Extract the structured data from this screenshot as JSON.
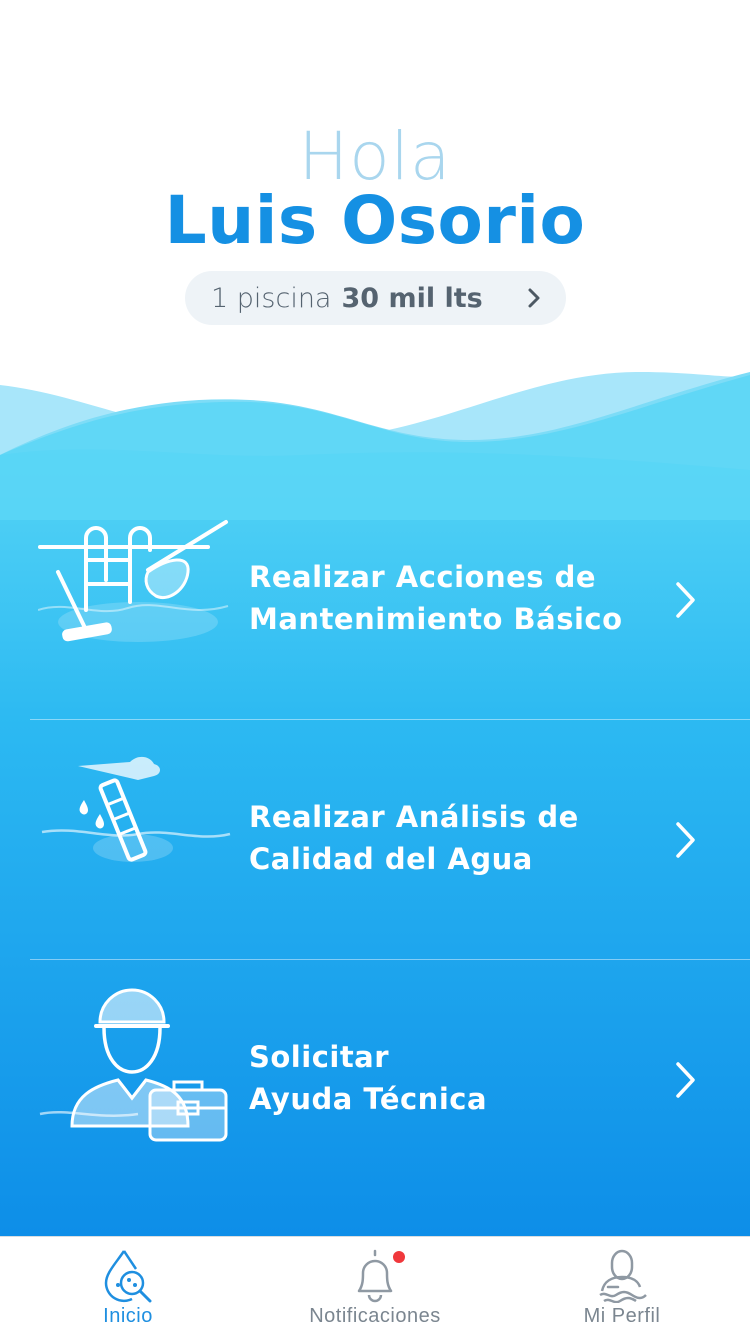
{
  "header": {
    "greeting": "Hola",
    "user_name": "Luis Osorio",
    "pool_count": "1 piscina",
    "pool_size": "30 mil lts"
  },
  "menu": [
    {
      "line1": "Realizar Acciones de",
      "line2": "Mantenimiento Básico",
      "icon": "pool-maintenance-icon"
    },
    {
      "line1": "Realizar Análisis de",
      "line2": "Calidad del Agua",
      "icon": "water-test-icon"
    },
    {
      "line1": "Solicitar",
      "line2": "Ayuda Técnica",
      "icon": "technician-icon"
    }
  ],
  "tabbar": {
    "tabs": [
      {
        "label": "Inicio",
        "icon": "water-drop-search-icon",
        "active": true
      },
      {
        "label": "Notificaciones",
        "icon": "bell-icon",
        "active": false,
        "has_badge": true
      },
      {
        "label": "Mi Perfil",
        "icon": "swimmer-profile-icon",
        "active": false
      }
    ]
  },
  "colors": {
    "accent": "#1590e3",
    "greeting": "#a9d6ee",
    "water_top": "#56d5f5",
    "water_bottom": "#0d8ee8",
    "badge": "#f0383c"
  }
}
